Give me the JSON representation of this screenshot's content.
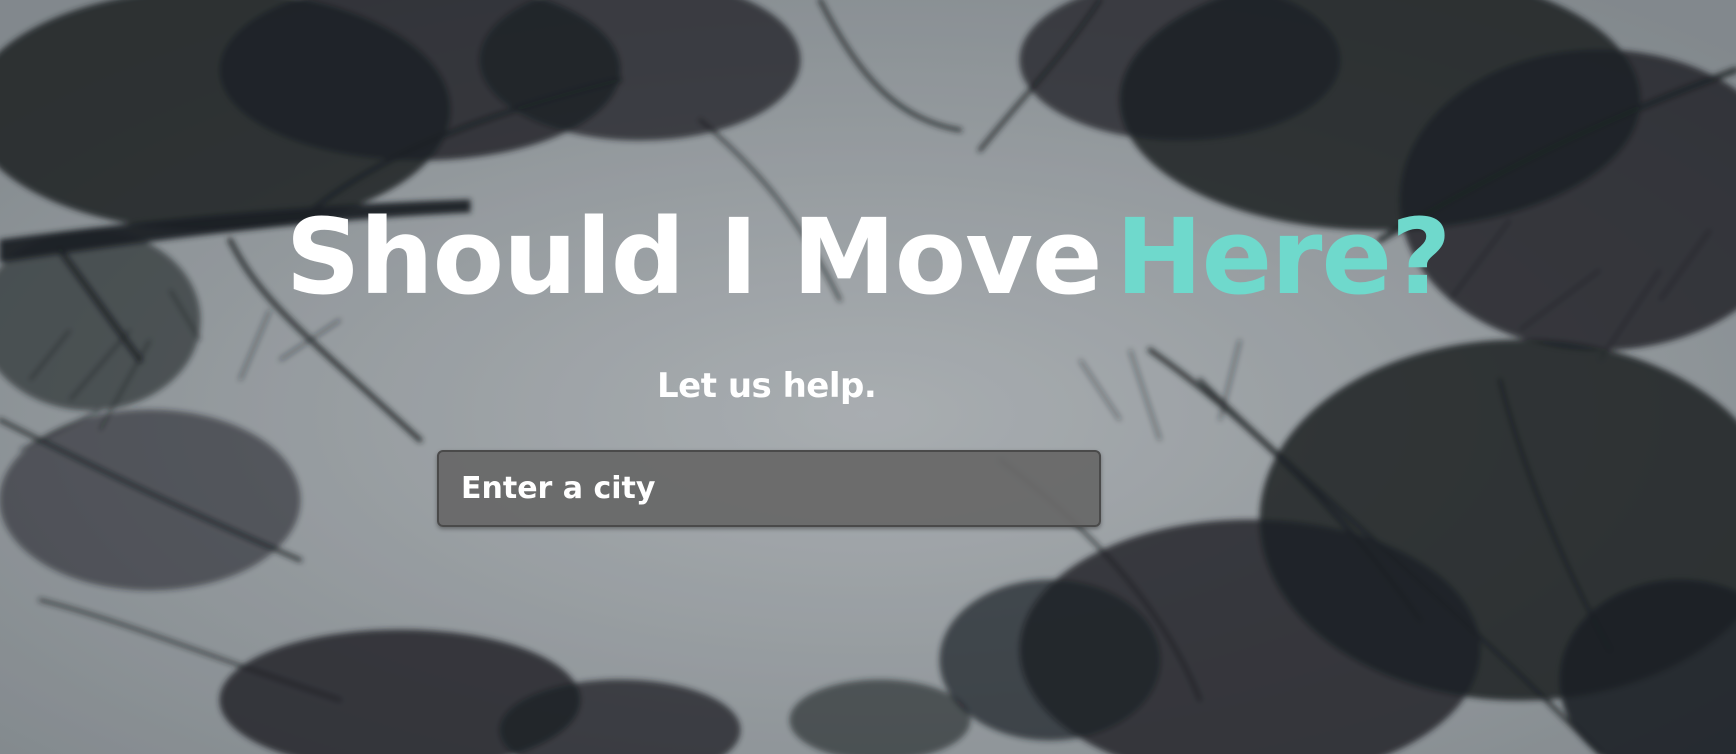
{
  "hero": {
    "title_main": "Should I Move",
    "title_accent": "Here?",
    "subtitle": "Let us help."
  },
  "search": {
    "placeholder": "Enter a city",
    "value": ""
  },
  "colors": {
    "accent": "#6fd9cc",
    "title": "#ffffff",
    "input_bg": "#686868",
    "background_sky": "#b7bcbf",
    "tree_silhouette": "#1f2427"
  },
  "background": {
    "icon": "tree-silhouette-photo"
  }
}
